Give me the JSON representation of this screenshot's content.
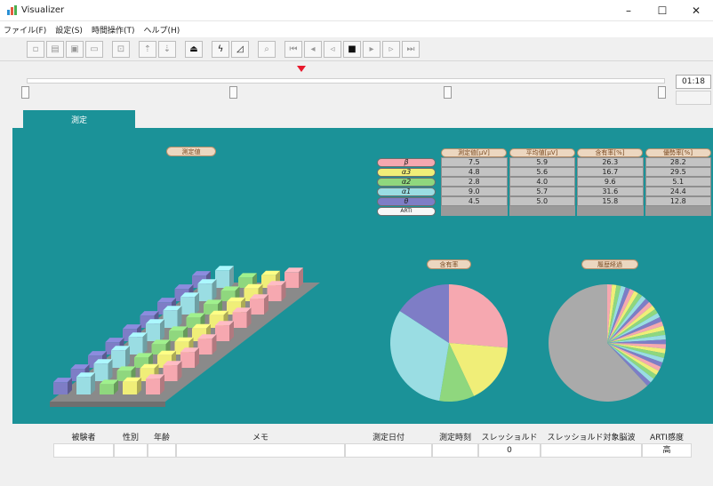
{
  "window": {
    "title": "Visualizer",
    "controls": [
      "–",
      "☐",
      "✕"
    ]
  },
  "menu": {
    "items": [
      "ファイル(F)",
      "設定(S)",
      "時間操作(T)",
      "ヘルプ(H)"
    ]
  },
  "timeline": {
    "time": "01:18"
  },
  "tabs": [
    {
      "label": "測定"
    }
  ],
  "measurement": {
    "title": "測定値",
    "columns": [
      "測定値[μV]",
      "平均値[μV]",
      "含有率[%]",
      "優勢率[%]"
    ],
    "rows": [
      {
        "label": "β",
        "color": "#f6a8b0",
        "values": [
          "7.5",
          "5.9",
          "26.3",
          "28.2"
        ]
      },
      {
        "label": "α3",
        "color": "#f0ee78",
        "values": [
          "4.8",
          "5.6",
          "16.7",
          "29.5"
        ]
      },
      {
        "label": "α2",
        "color": "#8fd77e",
        "values": [
          "2.8",
          "4.0",
          "9.6",
          "5.1"
        ]
      },
      {
        "label": "α1",
        "color": "#9adde3",
        "values": [
          "9.0",
          "5.7",
          "31.6",
          "24.4"
        ]
      },
      {
        "label": "θ",
        "color": "#7e7dc6",
        "values": [
          "4.5",
          "5.0",
          "15.8",
          "12.8"
        ]
      },
      {
        "label": "ARTI",
        "color": "#f5f5f5",
        "values": [
          "",
          "",
          "",
          ""
        ]
      }
    ]
  },
  "content_pie": {
    "title": "含有率",
    "values": [
      26.3,
      16.7,
      9.6,
      31.6,
      15.8
    ]
  },
  "history_pie": {
    "title": "履歴経過"
  },
  "subject": {
    "headers": [
      "被験者",
      "性別",
      "年齢",
      "メモ",
      "測定日付",
      "測定時刻",
      "スレッショルド",
      "スレッショルド対象脳波",
      "ARTI感度"
    ],
    "values": [
      "",
      "",
      "",
      "",
      "",
      "",
      "0",
      "",
      "高"
    ]
  },
  "colors": {
    "panel": "#1b9298",
    "beta": "#f6a8b0",
    "alpha3": "#f0ee78",
    "alpha2": "#8fd77e",
    "alpha1": "#9adde3",
    "theta": "#7e7dc6",
    "gray": "#aaaaaa"
  }
}
